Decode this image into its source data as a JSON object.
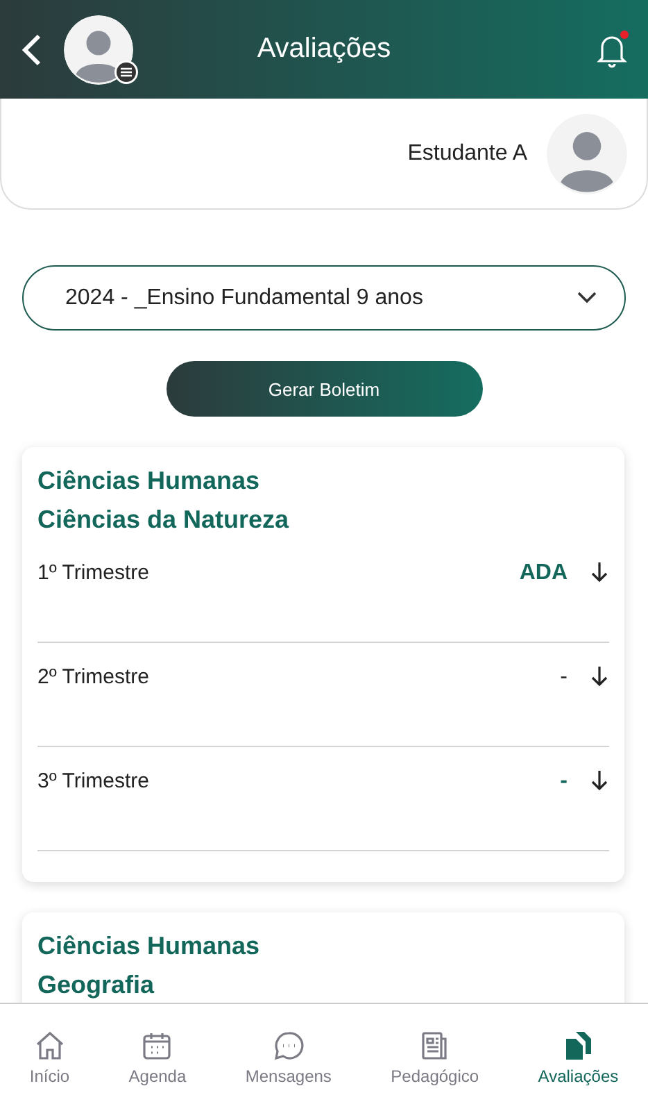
{
  "header": {
    "title": "Avaliações",
    "notification_unread": true
  },
  "student": {
    "name": "Estudante A"
  },
  "period_select": {
    "value": "2024 - _Ensino Fundamental 9 anos"
  },
  "report_button": {
    "label": "Gerar Boletim"
  },
  "subjects": [
    {
      "area": "Ciências Humanas",
      "name": "Ciências da Natureza",
      "terms": [
        {
          "label": "1º Trimestre",
          "grade": "ADA",
          "highlighted": true
        },
        {
          "label": "2º Trimestre",
          "grade": "-",
          "highlighted": false
        },
        {
          "label": "3º Trimestre",
          "grade": "-",
          "highlighted": true
        }
      ]
    },
    {
      "area": "Ciências Humanas",
      "name": "Geografia"
    }
  ],
  "nav": [
    {
      "label": "Início",
      "selected": false
    },
    {
      "label": "Agenda",
      "selected": false
    },
    {
      "label": "Mensagens",
      "selected": false
    },
    {
      "label": "Pedagógico",
      "selected": false
    },
    {
      "label": "Avaliações",
      "selected": true
    }
  ]
}
